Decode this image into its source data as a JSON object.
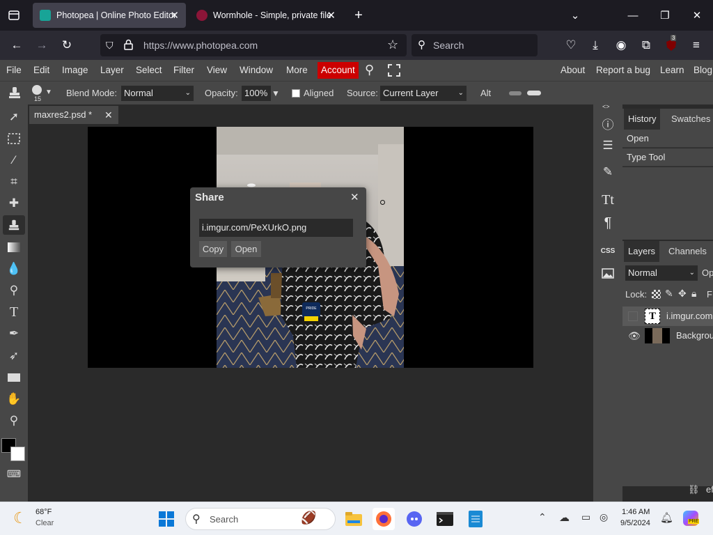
{
  "browser": {
    "tabs": [
      {
        "title": "Photopea | Online Photo Editor",
        "active": true
      },
      {
        "title": "Wormhole - Simple, private file",
        "active": false
      }
    ],
    "new_tab_glyph": "+",
    "url": "https://www.photopea.com",
    "search_placeholder": "Search",
    "extension_badge": "3"
  },
  "menu": {
    "items": [
      "File",
      "Edit",
      "Image",
      "Layer",
      "Select",
      "Filter",
      "View",
      "Window",
      "More"
    ],
    "account_label": "Account",
    "right_links": [
      "About",
      "Report a bug",
      "Learn",
      "Blog"
    ]
  },
  "options_bar": {
    "brush_size": "15",
    "blend_mode_label": "Blend Mode:",
    "blend_mode_value": "Normal",
    "opacity_label": "Opacity:",
    "opacity_value": "100%",
    "aligned_label": "Aligned",
    "source_label": "Source:",
    "source_value": "Current Layer",
    "alt_label": "Alt"
  },
  "document": {
    "tab_title": "maxres2.psd *",
    "badge_text": "PRIDE"
  },
  "share_dialog": {
    "title": "Share",
    "link_value": "i.imgur.com/PeXUrkO.png",
    "copy_label": "Copy",
    "open_label": "Open"
  },
  "right_iconbar": {
    "toggle_glyph": "<>",
    "css_label": "CSS"
  },
  "history_panel": {
    "tabs": [
      "History",
      "Swatches"
    ],
    "entries": [
      "Open",
      "Type Tool"
    ]
  },
  "layers_panel": {
    "tabs": [
      "Layers",
      "Channels"
    ],
    "blend_mode": "Normal",
    "opacity_label_partial": "Op",
    "lock_label": "Lock:",
    "fill_label_partial": "F",
    "layers": [
      {
        "name": "i.imgur.com",
        "type": "text"
      },
      {
        "name": "Background",
        "type": "image"
      }
    ],
    "footer_partial": "ef"
  },
  "taskbar": {
    "weather_temp": "68°F",
    "weather_desc": "Clear",
    "search_placeholder": "Search",
    "time": "1:46 AM",
    "date": "9/5/2024",
    "copilot_badge": "PRE"
  },
  "colors": {
    "accent_account": "#cc0000",
    "photopea_panel": "#474747",
    "workspace": "#2a2a2a",
    "browser_chrome": "#1c1b22"
  }
}
